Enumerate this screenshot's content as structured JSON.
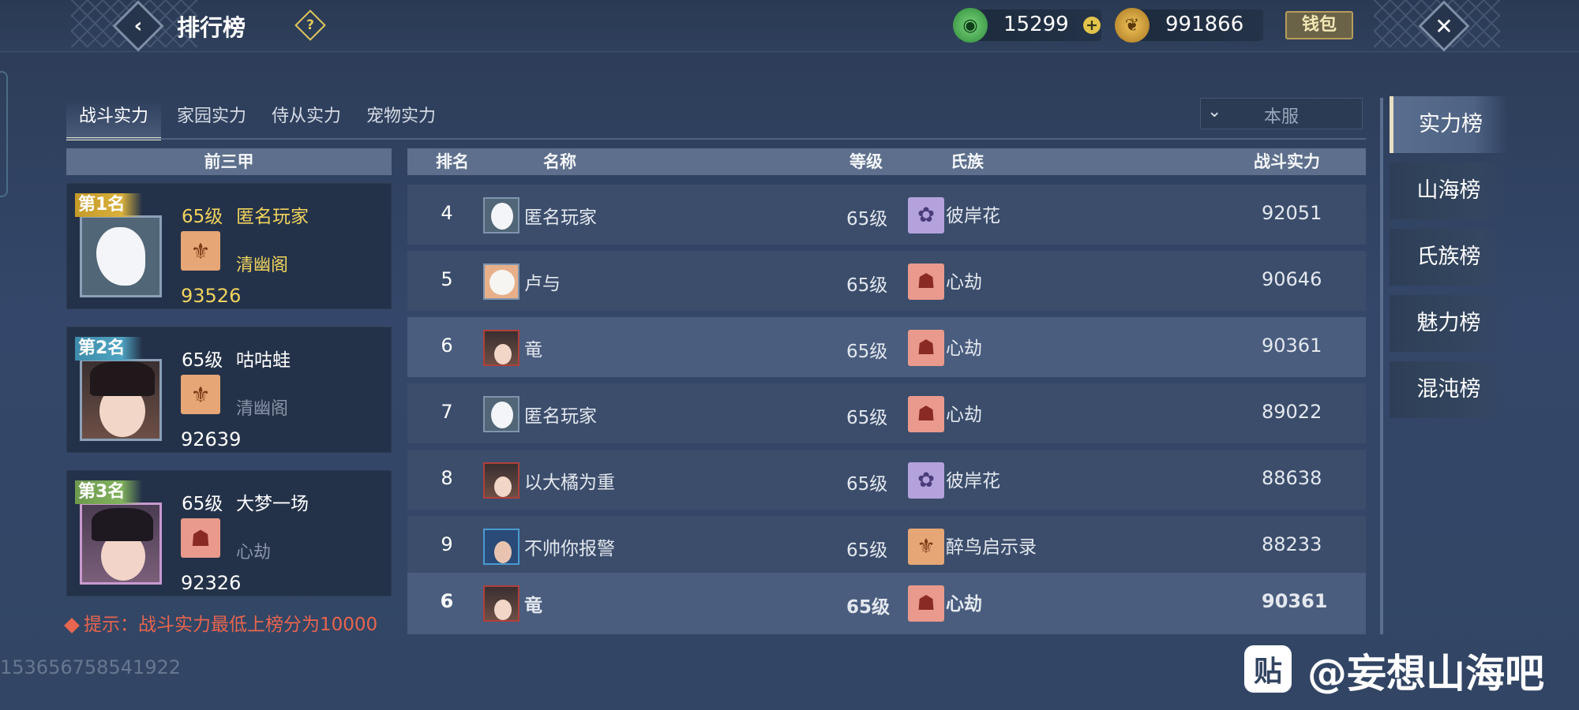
{
  "header": {
    "back_icon": "‹",
    "title": "排行榜",
    "help_icon": "?",
    "jade_value": "15299",
    "leaf_value": "991866",
    "wallet_label": "钱包",
    "close_icon": "✕"
  },
  "tabs": [
    {
      "label": "战斗实力"
    },
    {
      "label": "家园实力"
    },
    {
      "label": "侍从实力"
    },
    {
      "label": "宠物实力"
    }
  ],
  "server_select": {
    "value": "本服"
  },
  "top3": {
    "header": "前三甲",
    "cards": [
      {
        "rank": "第1名",
        "level": "65级",
        "name": "匿名玩家",
        "clan": "清幽阁",
        "power": "93526"
      },
      {
        "rank": "第2名",
        "level": "65级",
        "name": "咕咕蛙",
        "clan": "清幽阁",
        "power": "92639"
      },
      {
        "rank": "第3名",
        "level": "65级",
        "name": "大梦一场",
        "clan": "心劫",
        "power": "92326"
      }
    ],
    "tip": "提示：战斗实力最低上榜分为10000"
  },
  "table": {
    "columns": {
      "rank": "排名",
      "name": "名称",
      "level": "等级",
      "clan": "氏族",
      "power": "战斗实力"
    },
    "rows": [
      {
        "rank": "4",
        "name": "匿名玩家",
        "level": "65级",
        "clan": "彼岸花",
        "power": "92051"
      },
      {
        "rank": "5",
        "name": "卢与",
        "level": "65级",
        "clan": "心劫",
        "power": "90646"
      },
      {
        "rank": "6",
        "name": "竜",
        "level": "65级",
        "clan": "心劫",
        "power": "90361"
      },
      {
        "rank": "7",
        "name": "匿名玩家",
        "level": "65级",
        "clan": "心劫",
        "power": "89022"
      },
      {
        "rank": "8",
        "name": "以大橘为重",
        "level": "65级",
        "clan": "彼岸花",
        "power": "88638"
      },
      {
        "rank": "9",
        "name": "不帅你报警",
        "level": "65级",
        "clan": "醉鸟启示录",
        "power": "88233"
      }
    ],
    "self_row": {
      "rank": "6",
      "name": "竜",
      "level": "65级",
      "clan": "心劫",
      "power": "90361"
    }
  },
  "sidebar": {
    "items": [
      {
        "label": "实力榜"
      },
      {
        "label": "山海榜"
      },
      {
        "label": "氏族榜"
      },
      {
        "label": "魅力榜"
      },
      {
        "label": "混沌榜"
      }
    ]
  },
  "footer": {
    "uid": "153656758541922",
    "watermark_logo": "贴",
    "watermark_text": "@妄想山海吧"
  }
}
